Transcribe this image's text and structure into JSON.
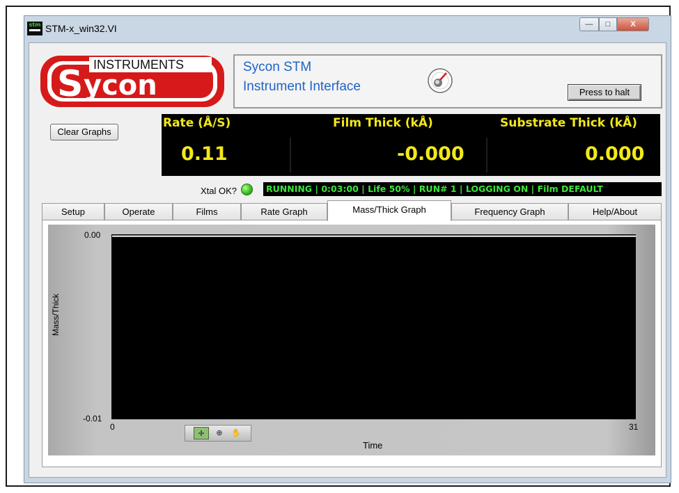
{
  "window": {
    "title": "STM-x_win32.VI",
    "icon_text": "stm",
    "buttons": {
      "minimize": "—",
      "maximize": "□",
      "close": "X"
    }
  },
  "header": {
    "logo": {
      "top_text": "INSTRUMENTS",
      "brand": "Sycon",
      "colors": {
        "red": "#d61a1a",
        "white": "#ffffff"
      }
    },
    "app_name": "Sycon STM",
    "app_subtitle": "Instrument Interface",
    "halt_button": "Press to halt"
  },
  "toolbar": {
    "clear_graphs": "Clear Graphs"
  },
  "readouts": {
    "rate_label": "Rate (Å/S)",
    "rate_value": "0.11",
    "film_label": "Film Thick (kÅ)",
    "film_value": "-0.000",
    "substrate_label": "Substrate Thick (kÅ)",
    "substrate_value": "0.000",
    "color": "#f2e81a"
  },
  "status": {
    "xtal_label": "Xtal OK?",
    "xtal_led_color": "#34c21d",
    "text": "RUNNING | 0:03:00 | Life 50% | RUN# 1 | LOGGING ON | Film DEFAULT"
  },
  "tabs": [
    {
      "label": "Setup"
    },
    {
      "label": "Operate"
    },
    {
      "label": "Films"
    },
    {
      "label": "Rate Graph"
    },
    {
      "label": "Mass/Thick Graph",
      "active": true
    },
    {
      "label": "Frequency Graph"
    },
    {
      "label": "Help/About"
    }
  ],
  "graph": {
    "y_title": "Mass/Thick",
    "x_title": "Time",
    "y_max_label": "0.00",
    "y_min_label": "-0.01",
    "x_min_label": "0",
    "x_max_label": "31",
    "tools": [
      "cursor",
      "zoom",
      "pan"
    ]
  },
  "chart_data": {
    "type": "line",
    "title": "",
    "xlabel": "Time",
    "ylabel": "Mass/Thick",
    "xlim": [
      0,
      31
    ],
    "ylim": [
      -0.01,
      0.0
    ],
    "x_ticks": [
      "0",
      "31"
    ],
    "y_ticks": [
      "0.00",
      "-0.01"
    ],
    "series": [
      {
        "values": [
          [
            0,
            -0.0001
          ],
          [
            31,
            -0.0001
          ]
        ],
        "color": "#ffffff"
      }
    ],
    "grid": false,
    "background": "#000000"
  }
}
